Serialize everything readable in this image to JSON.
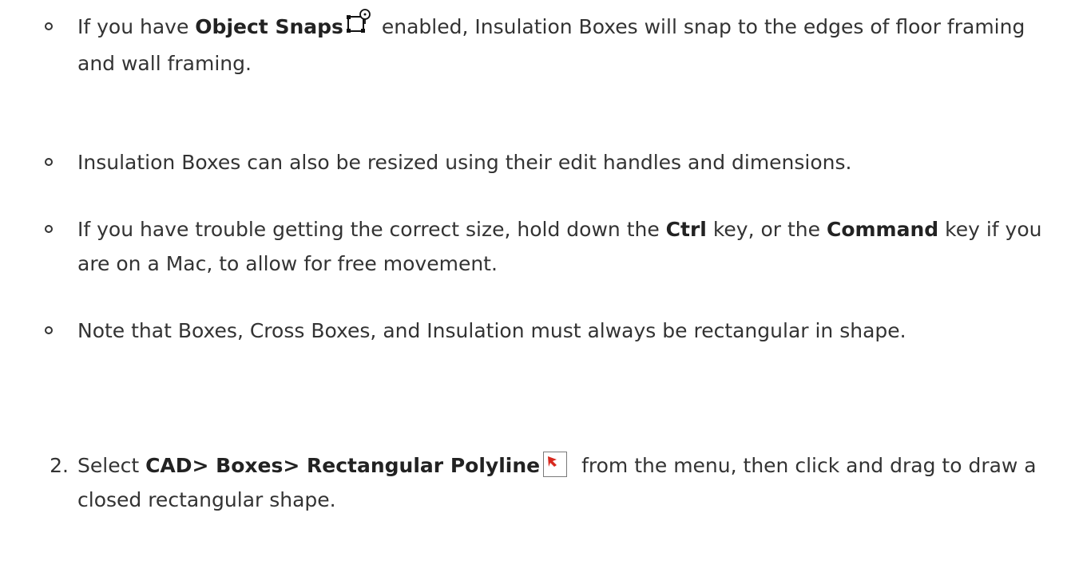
{
  "bullets": [
    {
      "pre": "If you have ",
      "bold": "Object Snaps",
      "icon": "object-snaps-icon",
      "post": " enabled, Insulation Boxes will snap to the edges of floor framing and wall framing."
    },
    {
      "text": "Insulation Boxes can also be resized using their edit handles and dimensions."
    },
    {
      "pre": "If you have trouble getting the correct size, hold down the ",
      "bold1": "Ctrl",
      "mid": " key, or the ",
      "bold2": "Command",
      "post": " key if you are on a Mac, to allow for free movement."
    },
    {
      "text": "Note that Boxes, Cross Boxes, and Insulation must always be rectangular in shape."
    }
  ],
  "step2": {
    "number": "2.",
    "pre": "Select ",
    "bold": "CAD> Boxes> Rectangular Polyline",
    "icon": "rectangular-polyline-icon",
    "post": "from the menu, then click and drag to draw a closed rectangular shape."
  },
  "colors": {
    "text": "#333333",
    "icon_red": "#d8281e"
  }
}
